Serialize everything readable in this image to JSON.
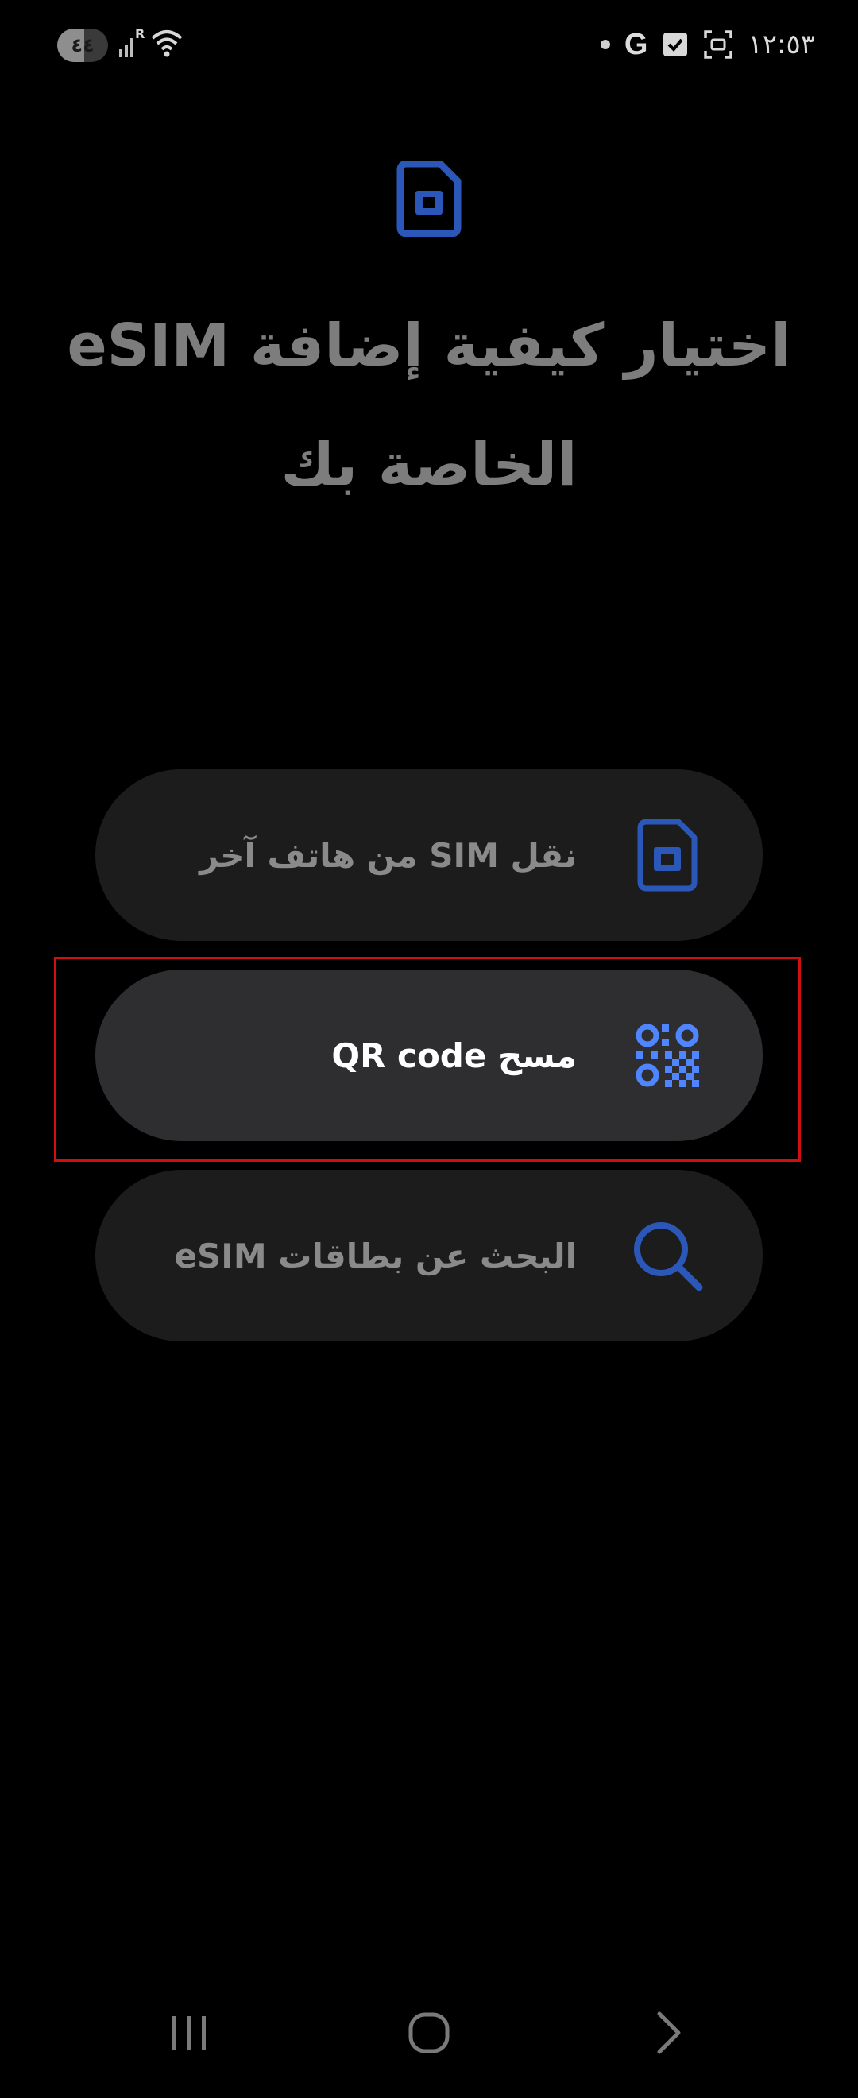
{
  "status_bar": {
    "battery_level": "٤٤",
    "network_roaming": "R",
    "time": "١٢:٥٣"
  },
  "header": {
    "icon": "sim-card-icon",
    "title": "اختيار كيفية إضافة eSIM الخاصة بك"
  },
  "options": [
    {
      "label": "نقل SIM من هاتف آخر",
      "icon": "sim-card-icon",
      "selected": false
    },
    {
      "label": "مسح QR code",
      "icon": "qr-code-icon",
      "selected": true
    },
    {
      "label": "البحث عن بطاقات eSIM",
      "icon": "search-icon",
      "selected": false
    }
  ],
  "colors": {
    "background": "#000000",
    "card": "#1c1c1c",
    "card_selected": "#2e2e31",
    "accent_blue": "#2f5fc4",
    "accent_blue_bright": "#4f86ff",
    "highlight_border": "#d01010"
  },
  "nav_bar": {
    "recents": "recents-icon",
    "home": "home-icon",
    "back": "back-icon"
  }
}
